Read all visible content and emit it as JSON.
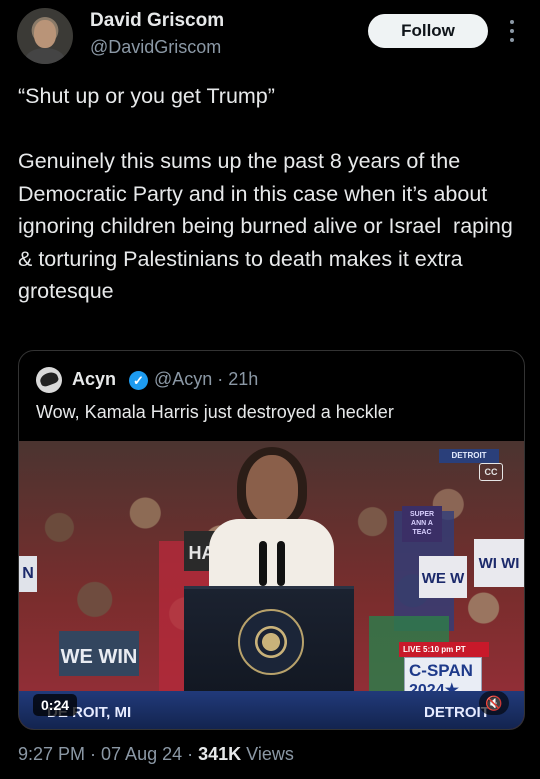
{
  "author": {
    "name": "David Griscom",
    "handle": "@DavidGriscom",
    "follow_label": "Follow"
  },
  "tweet": {
    "text": "“Shut up or you get Trump”\n\nGenuinely this sums up the past 8 years of the Democratic Party and in this case when it’s about ignoring children being burned alive or Israel  raping & torturing Palestinians to death makes it extra grotesque"
  },
  "quoted": {
    "name": "Acyn",
    "verified_icon": "verified-badge-icon",
    "handle_time": "@Acyn · 21h",
    "text": "Wow, Kamala Harris just destroyed a heckler",
    "video": {
      "duration": "0:24",
      "top_label": "DETROIT",
      "cc_label": "CC",
      "live_label": "LIVE  5:10 pm PT",
      "network_line1": "C-SPAN",
      "network_line2": "2024★",
      "banner_left": "DE   ROIT, MI",
      "banner_right": "DETROIT",
      "signs": {
        "we_win_left": "WE WIN",
        "ha": "HA",
        "we_w": "WE W",
        "wi_wi": "WI WI",
        "n": "N",
        "super": "SUPER ANN A TEAC"
      }
    }
  },
  "meta": {
    "time_date": "9:27 PM · 07 Aug 24 · ",
    "views_count": "341K",
    "views_label": " Views"
  },
  "colors": {
    "background": "#000000",
    "text_primary": "#e7e9ea",
    "text_secondary": "#8b98a5",
    "verified": "#1d9bf0",
    "follow_bg": "#eff3f4"
  }
}
